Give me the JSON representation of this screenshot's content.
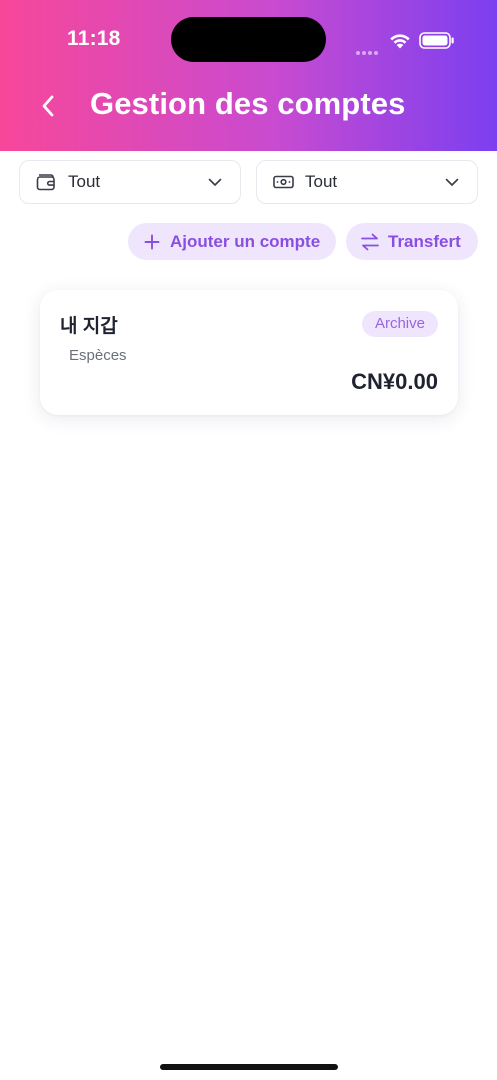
{
  "status_bar": {
    "time": "11:18"
  },
  "header": {
    "title": "Gestion des comptes"
  },
  "filters": {
    "account_type": {
      "label": "Tout",
      "icon": "wallet-icon"
    },
    "currency": {
      "label": "Tout",
      "icon": "banknote-icon"
    }
  },
  "actions": {
    "add_account": "Ajouter un compte",
    "transfer": "Transfert"
  },
  "accounts": [
    {
      "name": "내 지갑",
      "type": "Espèces",
      "badge": "Archive",
      "balance": "CN¥0.00"
    }
  ],
  "colors": {
    "gradient_start": "#f7479a",
    "gradient_end": "#7b3ff0",
    "accent": "#8a4fe0",
    "pill_bg": "#efe6fd"
  }
}
